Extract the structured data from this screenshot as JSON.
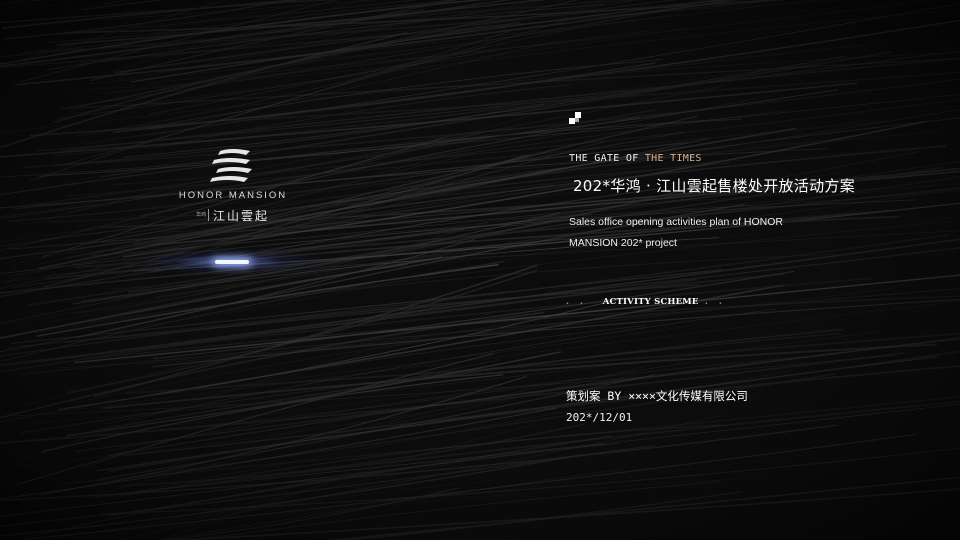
{
  "brand": {
    "name_en": "HONOR MANSION",
    "name_small": "华鸿",
    "name_cn": "江山雲起"
  },
  "slide": {
    "tagline_prefix": "THE GATE OF ",
    "tagline_highlight": "THE TIMES",
    "title_cn": "202*华鸿 · 江山雲起售楼处开放活动方案",
    "subtitle_line1": "Sales office opening activities plan of HONOR",
    "subtitle_line2": "MANSION 202* project",
    "scheme_dots_left": ". .",
    "scheme_label": "ACTIVITY SCHEME",
    "scheme_dots_right": ". .",
    "planner": "策划案 BY ××××文化传媒有限公司",
    "date": "202*/12/01"
  },
  "colors": {
    "background": "#0b0b0b",
    "text": "#ffffff",
    "accent": "#d8b08a",
    "flare": "#a0b9ff"
  },
  "icons": [
    "honor-mansion-logo-icon",
    "pixel-square-icon"
  ]
}
